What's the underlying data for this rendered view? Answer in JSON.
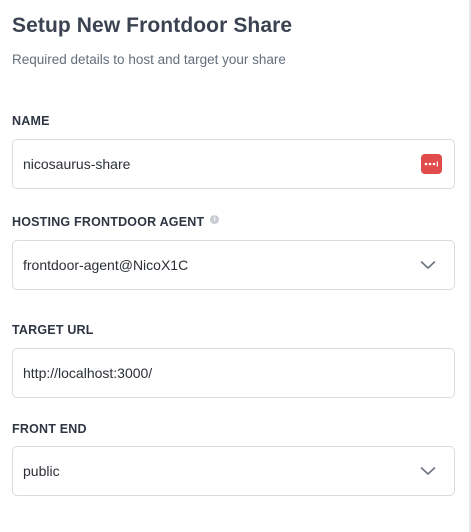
{
  "header": {
    "title": "Setup New Frontdoor Share",
    "subtitle": "Required details to host and target your share"
  },
  "form": {
    "name": {
      "label": "NAME",
      "value": "nicosaurus-share",
      "icon": "password-manager-dots-icon",
      "icon_color": "#e04b4b"
    },
    "hosting_agent": {
      "label": "HOSTING FRONTDOOR AGENT",
      "info_icon": "info-icon",
      "value": "frontdoor-agent@NicoX1C",
      "icon": "chevron-down-icon"
    },
    "target_url": {
      "label": "TARGET URL",
      "value": "http://localhost:3000/"
    },
    "front_end": {
      "label": "FRONT END",
      "value": "public",
      "icon": "chevron-down-icon"
    }
  }
}
